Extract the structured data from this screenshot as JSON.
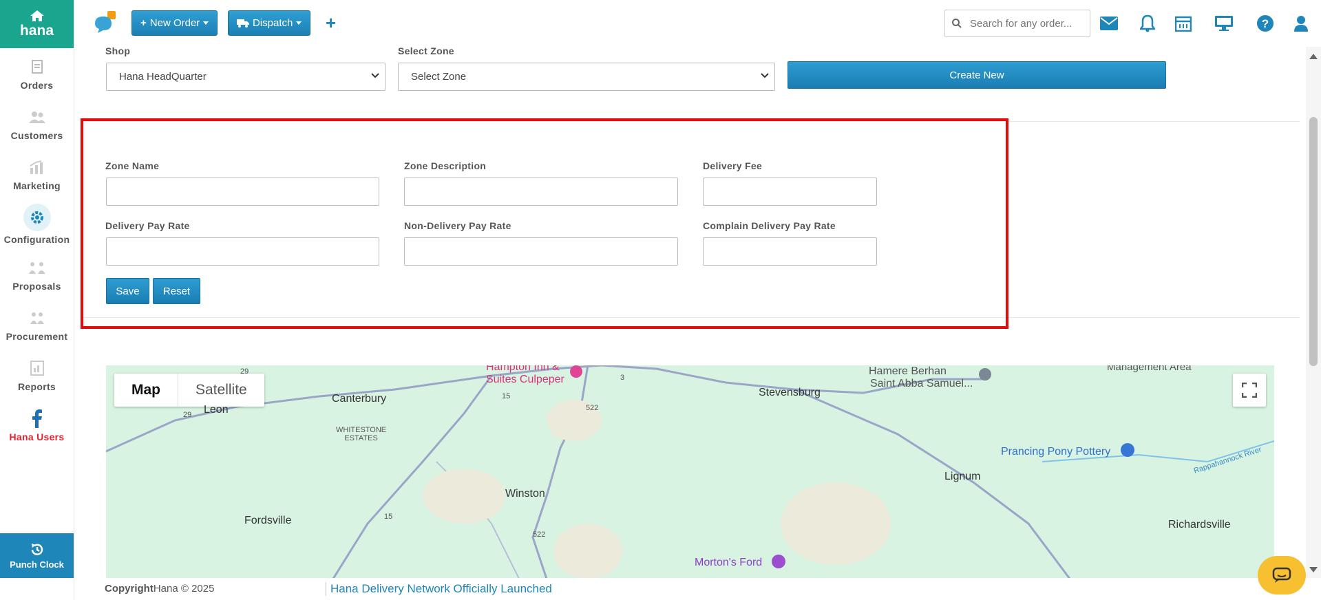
{
  "app": {
    "brand": "hana"
  },
  "sidebar": {
    "items": [
      {
        "label": "Orders",
        "icon": "orders-icon"
      },
      {
        "label": "Customers",
        "icon": "customers-icon"
      },
      {
        "label": "Marketing",
        "icon": "marketing-icon"
      },
      {
        "label": "Configuration",
        "icon": "configuration-icon",
        "active": true
      },
      {
        "label": "Proposals",
        "icon": "proposals-icon"
      },
      {
        "label": "Procurement",
        "icon": "procurement-icon"
      },
      {
        "label": "Reports",
        "icon": "reports-icon"
      },
      {
        "label": "Hana Users",
        "icon": "facebook-icon"
      }
    ],
    "punch_clock": "Punch Clock"
  },
  "topbar": {
    "new_order": "New Order",
    "dispatch": "Dispatch",
    "search_placeholder": "Search for any order..."
  },
  "filters": {
    "shop_label": "Shop",
    "shop_value": "Hana HeadQuarter",
    "zone_label": "Select Zone",
    "zone_value": "Select Zone",
    "create_new": "Create New"
  },
  "form": {
    "zone_name": "Zone Name",
    "zone_description": "Zone Description",
    "delivery_fee": "Delivery Fee",
    "delivery_pay_rate": "Delivery Pay Rate",
    "non_delivery_pay_rate": "Non-Delivery Pay Rate",
    "complain_delivery_pay_rate": "Complain Delivery Pay Rate",
    "save": "Save",
    "reset": "Reset"
  },
  "map": {
    "map_tab": "Map",
    "satellite_tab": "Satellite",
    "places": {
      "canterbury": "Canterbury",
      "leon": "Leon",
      "whitestone_1": "WHITESTONE",
      "whitestone_2": "ESTATES",
      "hampton_1": "Hampton Inn &",
      "hampton_2": "Suites Culpeper",
      "stevensburg": "Stevensburg",
      "hamere": "Hamere Berhan",
      "saint_abba": "Saint Abba Samuel...",
      "management": "Management Area",
      "prancing": "Prancing Pony Pottery",
      "rappahannock": "Rappahannock River",
      "lignum": "Lignum",
      "winston": "Winston",
      "fordsville": "Fordsville",
      "richardsville": "Richardsville",
      "mortons_ford": "Morton's Ford"
    },
    "route_labels": {
      "r29a": "29",
      "r29b": "29",
      "r15a": "15",
      "r15b": "15",
      "r3": "3",
      "r522a": "522",
      "r522b": "522"
    }
  },
  "footer": {
    "copyright_bold": "Copyright",
    "copyright_rest": "Hana © 2025",
    "news": "Hana Delivery Network Officially Launched"
  },
  "colors": {
    "accent": "#1e86b8",
    "brand": "#1aa58f",
    "highlight": "#e30b0b",
    "map_bg": "#d8f3e1"
  }
}
